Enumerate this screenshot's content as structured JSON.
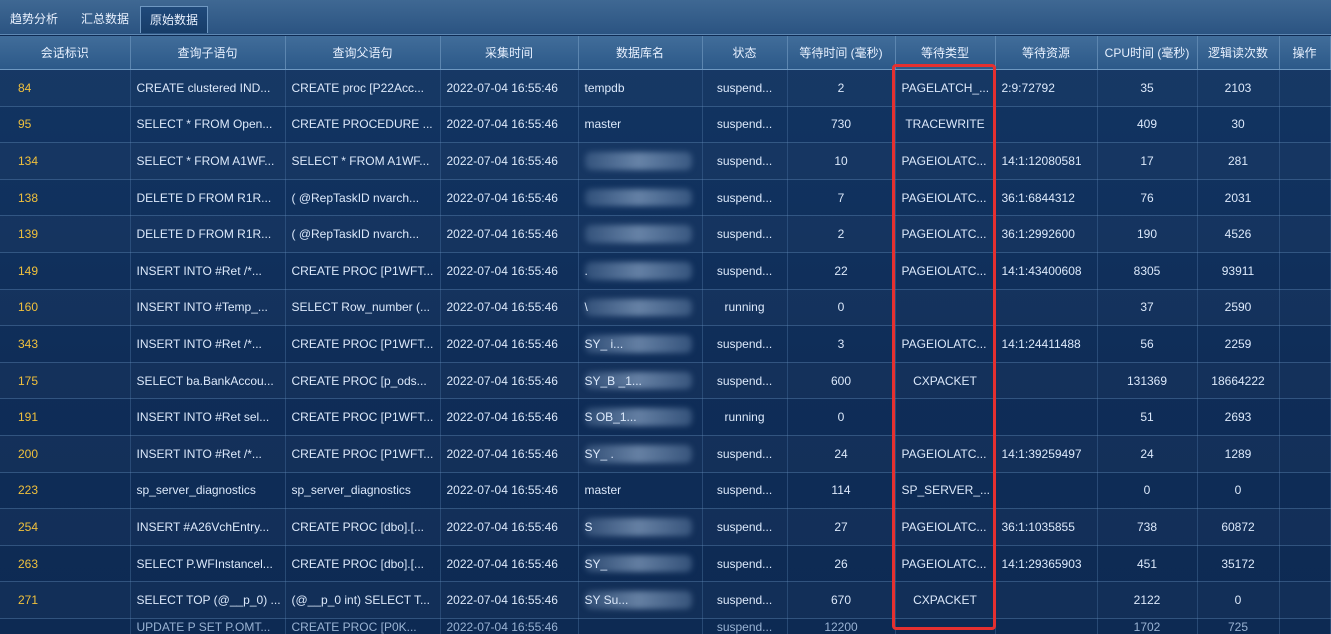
{
  "tabs": [
    {
      "label": "趋势分析",
      "active": false
    },
    {
      "label": "汇总数据",
      "active": false
    },
    {
      "label": "原始数据",
      "active": true
    }
  ],
  "columns": [
    "会话标识",
    "查询子语句",
    "查询父语句",
    "采集时间",
    "数据库名",
    "状态",
    "等待时间 (毫秒)",
    "等待类型",
    "等待资源",
    "CPU时间 (毫秒)",
    "逻辑读次数",
    "操作"
  ],
  "rows": [
    {
      "sid": "84",
      "sub": "CREATE clustered IND...",
      "parent": "CREATE proc [P22Acc...",
      "time": "2022-07-04 16:55:46",
      "db": "tempdb",
      "status": "suspend...",
      "wait": "2",
      "type": "PAGELATCH_...",
      "res": "2:9:72792",
      "cpu": "35",
      "reads": "2103"
    },
    {
      "sid": "95",
      "sub": "SELECT * FROM Open...",
      "parent": "CREATE PROCEDURE ...",
      "time": "2022-07-04 16:55:46",
      "db": "master",
      "status": "suspend...",
      "wait": "730",
      "type": "TRACEWRITE",
      "res": "",
      "cpu": "409",
      "reads": "30"
    },
    {
      "sid": "134",
      "sub": "SELECT * FROM A1WF...",
      "parent": "SELECT * FROM A1WF...",
      "time": "2022-07-04 16:55:46",
      "db": "",
      "status": "suspend...",
      "wait": "10",
      "type": "PAGEIOLATC...",
      "res": "14:1:12080581",
      "cpu": "17",
      "reads": "281"
    },
    {
      "sid": "138",
      "sub": "DELETE D FROM R1R...",
      "parent": "( @RepTaskID nvarch...",
      "time": "2022-07-04 16:55:46",
      "db": "",
      "status": "suspend...",
      "wait": "7",
      "type": "PAGEIOLATC...",
      "res": "36:1:6844312",
      "cpu": "76",
      "reads": "2031"
    },
    {
      "sid": "139",
      "sub": "DELETE D FROM R1R...",
      "parent": "( @RepTaskID nvarch...",
      "time": "2022-07-04 16:55:46",
      "db": "",
      "status": "suspend...",
      "wait": "2",
      "type": "PAGEIOLATC...",
      "res": "36:1:2992600",
      "cpu": "190",
      "reads": "4526"
    },
    {
      "sid": "149",
      "sub": "INSERT INTO #Ret /*...",
      "parent": "CREATE PROC [P1WFT...",
      "time": "2022-07-04 16:55:46",
      "db": ".",
      "status": "suspend...",
      "wait": "22",
      "type": "PAGEIOLATC...",
      "res": "14:1:43400608",
      "cpu": "8305",
      "reads": "93911"
    },
    {
      "sid": "160",
      "sub": "INSERT INTO #Temp_...",
      "parent": "SELECT Row_number (...",
      "time": "2022-07-04 16:55:46",
      "db": "\\",
      "status": "running",
      "wait": "0",
      "type": "",
      "res": "",
      "cpu": "37",
      "reads": "2590"
    },
    {
      "sid": "343",
      "sub": "INSERT INTO #Ret /*...",
      "parent": "CREATE PROC [P1WFT...",
      "time": "2022-07-04 16:55:46",
      "db": "SY_ i...",
      "status": "suspend...",
      "wait": "3",
      "type": "PAGEIOLATC...",
      "res": "14:1:24411488",
      "cpu": "56",
      "reads": "2259"
    },
    {
      "sid": "175",
      "sub": "SELECT ba.BankAccou...",
      "parent": "CREATE PROC [p_ods...",
      "time": "2022-07-04 16:55:46",
      "db": "SY_B _1...",
      "status": "suspend...",
      "wait": "600",
      "type": "CXPACKET",
      "res": "",
      "cpu": "131369",
      "reads": "18664222"
    },
    {
      "sid": "191",
      "sub": "INSERT INTO #Ret sel...",
      "parent": "CREATE PROC [P1WFT...",
      "time": "2022-07-04 16:55:46",
      "db": "S OB_1...",
      "status": "running",
      "wait": "0",
      "type": "",
      "res": "",
      "cpu": "51",
      "reads": "2693"
    },
    {
      "sid": "200",
      "sub": "INSERT INTO #Ret /*...",
      "parent": "CREATE PROC [P1WFT...",
      "time": "2022-07-04 16:55:46",
      "db": "SY_ .",
      "status": "suspend...",
      "wait": "24",
      "type": "PAGEIOLATC...",
      "res": "14:1:39259497",
      "cpu": "24",
      "reads": "1289"
    },
    {
      "sid": "223",
      "sub": "sp_server_diagnostics",
      "parent": "sp_server_diagnostics",
      "time": "2022-07-04 16:55:46",
      "db": "master",
      "status": "suspend...",
      "wait": "114",
      "type": "SP_SERVER_...",
      "res": "",
      "cpu": "0",
      "reads": "0"
    },
    {
      "sid": "254",
      "sub": "INSERT #A26VchEntry...",
      "parent": "CREATE PROC [dbo].[...",
      "time": "2022-07-04 16:55:46",
      "db": "S",
      "status": "suspend...",
      "wait": "27",
      "type": "PAGEIOLATC...",
      "res": "36:1:1035855",
      "cpu": "738",
      "reads": "60872"
    },
    {
      "sid": "263",
      "sub": "SELECT P.WFInstancel...",
      "parent": "CREATE PROC [dbo].[...",
      "time": "2022-07-04 16:55:46",
      "db": "SY_",
      "status": "suspend...",
      "wait": "26",
      "type": "PAGEIOLATC...",
      "res": "14:1:29365903",
      "cpu": "451",
      "reads": "35172"
    },
    {
      "sid": "271",
      "sub": "SELECT TOP (@__p_0) ...",
      "parent": "(@__p_0 int) SELECT T...",
      "time": "2022-07-04 16:55:46",
      "db": "SY Su...",
      "status": "suspend...",
      "wait": "670",
      "type": "CXPACKET",
      "res": "",
      "cpu": "2122",
      "reads": "0"
    },
    {
      "sid": "",
      "sub": "UPDATE P SET P.OMT...",
      "parent": "CREATE PROC [P0K...",
      "time": "2022-07-04 16:55:46",
      "db": "",
      "status": "suspend...",
      "wait": "12200",
      "type": "",
      "res": "",
      "cpu": "1702",
      "reads": "725"
    }
  ],
  "masked_db_rows": [
    2,
    3,
    4,
    5,
    6,
    7,
    8,
    9,
    10,
    12,
    13,
    14
  ],
  "colors": {
    "header_bg": "#2c5989",
    "body_bg": "#0f2d58",
    "session_id": "#f0c03c",
    "highlight": "#e53030"
  }
}
